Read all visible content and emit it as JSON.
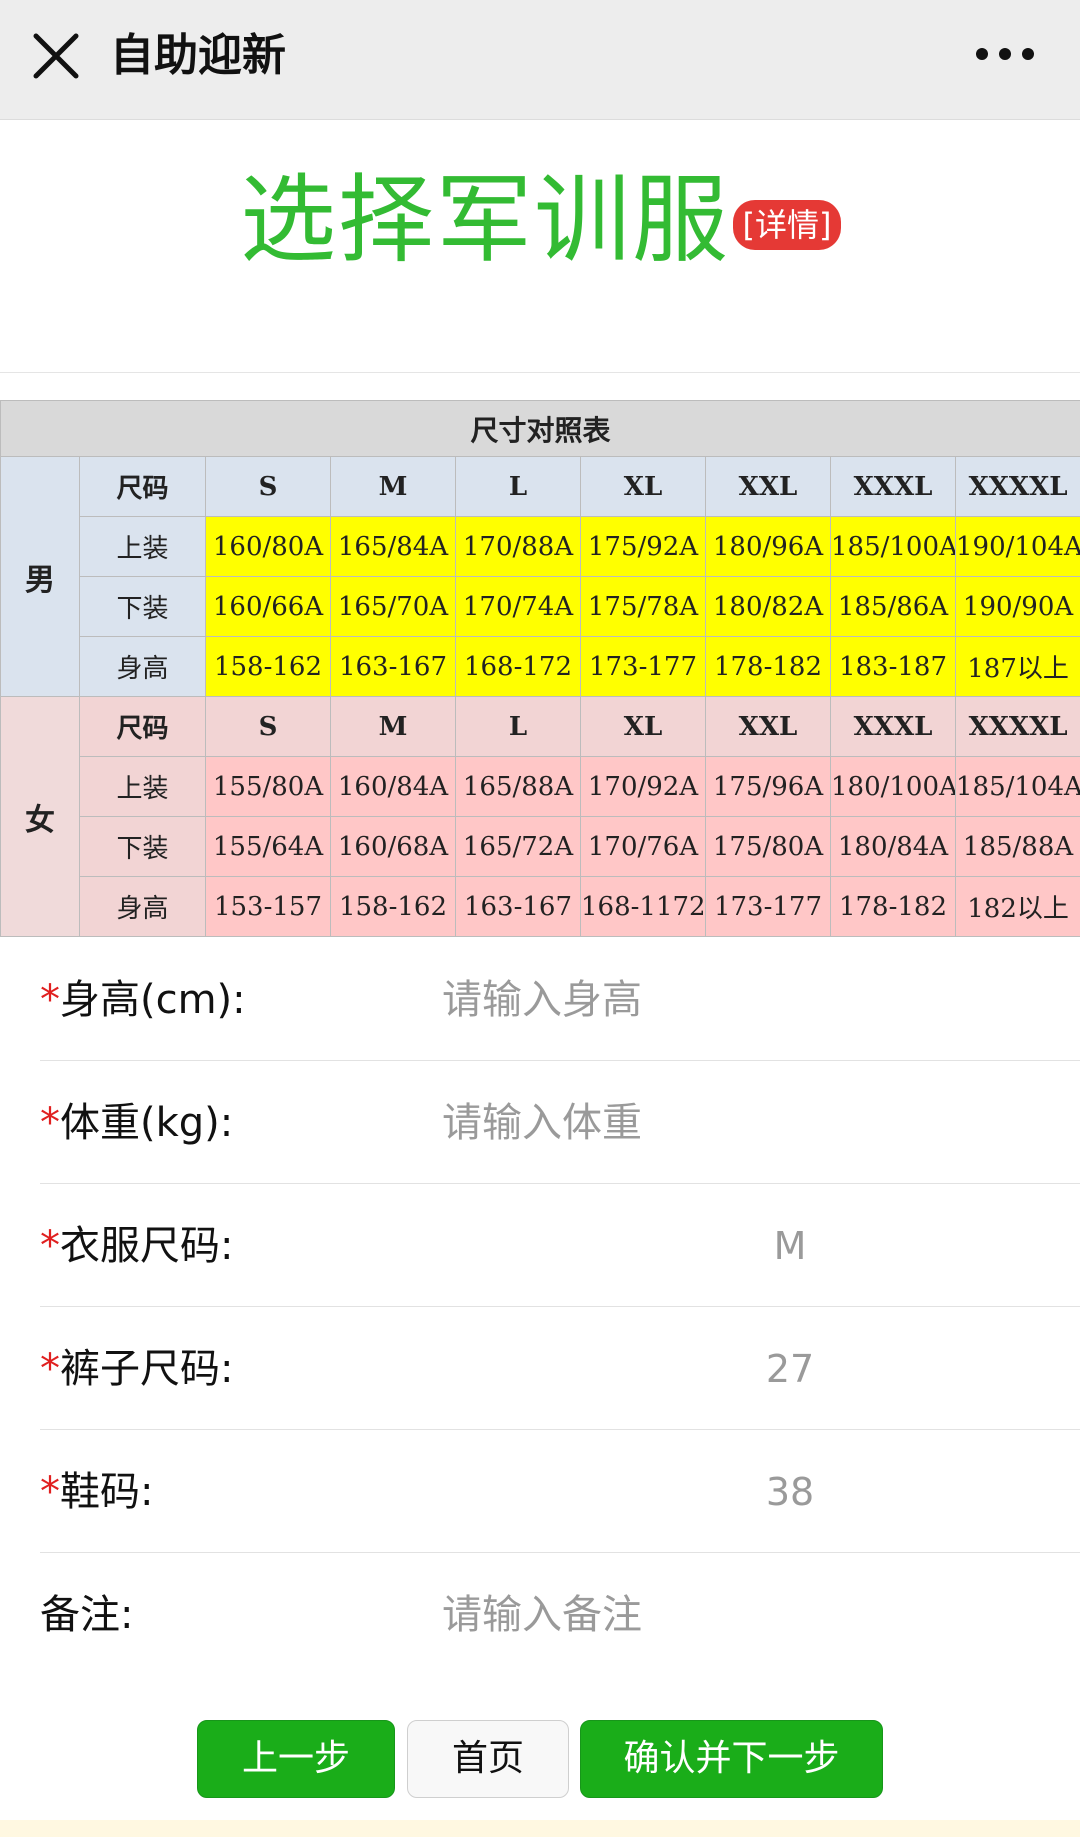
{
  "topbar": {
    "title": "自助迎新"
  },
  "heading": {
    "title": "选择军训服",
    "detail_badge": "[详情]"
  },
  "size_chart": {
    "caption": "尺寸对照表",
    "male": {
      "group": "男",
      "header_label": "尺码",
      "sizes": [
        "S",
        "M",
        "L",
        "XL",
        "XXL",
        "XXXL",
        "XXXXL"
      ],
      "rows": [
        {
          "label": "上装",
          "values": [
            "160/80A",
            "165/84A",
            "170/88A",
            "175/92A",
            "180/96A",
            "185/100A",
            "190/104A"
          ]
        },
        {
          "label": "下装",
          "values": [
            "160/66A",
            "165/70A",
            "170/74A",
            "175/78A",
            "180/82A",
            "185/86A",
            "190/90A"
          ]
        },
        {
          "label": "身高",
          "values": [
            "158-162",
            "163-167",
            "168-172",
            "173-177",
            "178-182",
            "183-187",
            "187以上"
          ]
        }
      ]
    },
    "female": {
      "group": "女",
      "header_label": "尺码",
      "sizes": [
        "S",
        "M",
        "L",
        "XL",
        "XXL",
        "XXXL",
        "XXXXL"
      ],
      "rows": [
        {
          "label": "上装",
          "values": [
            "155/80A",
            "160/84A",
            "165/88A",
            "170/92A",
            "175/96A",
            "180/100A",
            "185/104A"
          ]
        },
        {
          "label": "下装",
          "values": [
            "155/64A",
            "160/68A",
            "165/72A",
            "170/76A",
            "175/80A",
            "180/84A",
            "185/88A"
          ]
        },
        {
          "label": "身高",
          "values": [
            "153-157",
            "158-162",
            "163-167",
            "168-1172",
            "173-177",
            "178-182",
            "182以上"
          ]
        }
      ]
    }
  },
  "form": {
    "required_mark": "*",
    "height": {
      "label": "身高(cm):",
      "placeholder": "请输入身高"
    },
    "weight": {
      "label": "体重(kg):",
      "placeholder": "请输入体重"
    },
    "clothes_size": {
      "label": "衣服尺码:",
      "value": "M"
    },
    "pants_size": {
      "label": "裤子尺码:",
      "value": "27"
    },
    "shoe_size": {
      "label": "鞋码:",
      "value": "38"
    },
    "remark": {
      "label": "备注:",
      "placeholder": "请输入备注"
    }
  },
  "buttons": {
    "prev": "上一步",
    "home": "首页",
    "confirm_next": "确认并下一步"
  },
  "colors": {
    "title_green": "#33bb33",
    "badge_red": "#e53935",
    "button_green": "#1aad19",
    "male_highlight": "#ffff00",
    "female_highlight": "#ffc7c7"
  }
}
